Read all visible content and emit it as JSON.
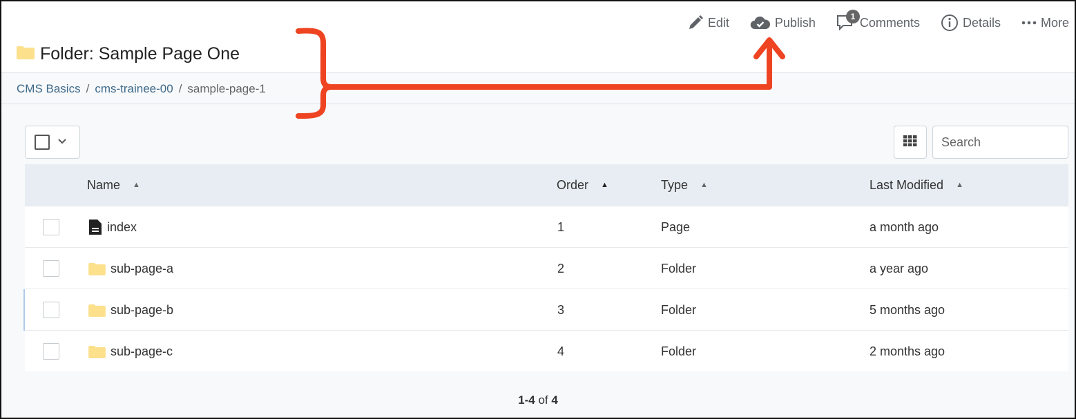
{
  "toolbar": {
    "edit": "Edit",
    "publish": "Publish",
    "comments": "Comments",
    "comments_count": "1",
    "details": "Details",
    "more": "More"
  },
  "page": {
    "title": "Folder: Sample Page One"
  },
  "breadcrumb": {
    "items": [
      "CMS Basics",
      "cms-trainee-00"
    ],
    "current": "sample-page-1",
    "separator": "/"
  },
  "search": {
    "placeholder": "Search"
  },
  "table": {
    "columns": [
      "Name",
      "Order",
      "Type",
      "Last Modified"
    ],
    "rows": [
      {
        "name": "index",
        "icon": "page-icon",
        "order": "1",
        "type": "Page",
        "modified": "a month ago"
      },
      {
        "name": "sub-page-a",
        "icon": "folder-icon",
        "order": "2",
        "type": "Folder",
        "modified": "a year ago"
      },
      {
        "name": "sub-page-b",
        "icon": "folder-icon",
        "order": "3",
        "type": "Folder",
        "modified": "5 months ago"
      },
      {
        "name": "sub-page-c",
        "icon": "folder-icon",
        "order": "4",
        "type": "Folder",
        "modified": "2 months ago"
      }
    ]
  },
  "pagination": {
    "range": "1-4",
    "of": "of",
    "total": "4"
  },
  "colors": {
    "folder": "#fce08c",
    "link": "#3f6a8a",
    "annotation": "#ee4422",
    "header_row": "#e7edf3"
  }
}
